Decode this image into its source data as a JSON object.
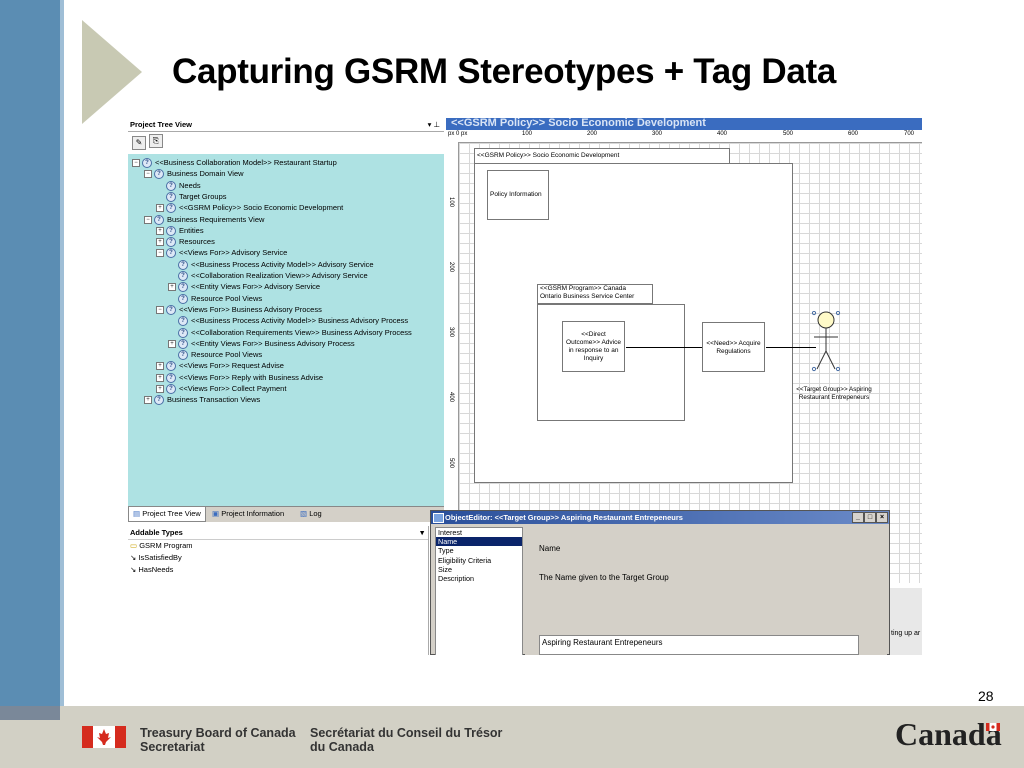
{
  "slide": {
    "title": "Capturing GSRM Stereotypes + Tag Data",
    "page_number": "28",
    "footer": {
      "en_line1": "Treasury Board of Canada",
      "en_line2": "Secretariat",
      "fr_line1": "Secrétariat du Conseil du Trésor",
      "fr_line2": "du Canada",
      "wordmark": "Canada"
    }
  },
  "project_tree": {
    "title": "Project Tree View",
    "pin_glyph": "▾ ⊥",
    "items": [
      {
        "label": "<<Business Collaboration Model>> Restaurant Startup",
        "expander": "−"
      },
      {
        "label": "Business Domain View",
        "expander": "−"
      },
      {
        "label": "Needs",
        "expander": ""
      },
      {
        "label": "Target Groups",
        "expander": ""
      },
      {
        "label": "<<GSRM Policy>> Socio Economic Development",
        "expander": "+"
      },
      {
        "label": "Business Requirements View",
        "expander": "−"
      },
      {
        "label": "Entities",
        "expander": "+"
      },
      {
        "label": "Resources",
        "expander": "+"
      },
      {
        "label": "<<Views For>> Advisory Service",
        "expander": "−"
      },
      {
        "label": "<<Business Process Activity Model>> Advisory Service",
        "expander": ""
      },
      {
        "label": "<<Collaboration Realization View>> Advisory Service",
        "expander": ""
      },
      {
        "label": "<<Entity Views For>> Advisory Service",
        "expander": "+"
      },
      {
        "label": "Resource Pool Views",
        "expander": ""
      },
      {
        "label": "<<Views For>> Business Advisory Process",
        "expander": "−"
      },
      {
        "label": "<<Business Process Activity Model>> Business Advisory Process",
        "expander": ""
      },
      {
        "label": "<<Collaboration Requirements View>> Business Advisory Process",
        "expander": ""
      },
      {
        "label": "<<Entity Views For>> Business Advisory Process",
        "expander": "+"
      },
      {
        "label": "Resource Pool Views",
        "expander": ""
      },
      {
        "label": "<<Views For>> Request Advise",
        "expander": "+"
      },
      {
        "label": "<<Views For>> Reply with Business Advise",
        "expander": "+"
      },
      {
        "label": "<<Views For>> Collect Payment",
        "expander": "+"
      },
      {
        "label": "Business Transaction Views",
        "expander": "+"
      }
    ],
    "tabs": [
      "Project Tree View",
      "Project Information",
      "Log"
    ]
  },
  "addable_types": {
    "title": "Addable Types",
    "items": [
      "GSRM Program",
      "IsSatisfiedBy",
      "HasNeeds"
    ]
  },
  "diagram": {
    "title": "<<GSRM Policy>> Socio Economic Development",
    "ruler_top": [
      "0 px",
      "100",
      "200",
      "300",
      "400",
      "500",
      "600",
      "700"
    ],
    "ruler_left": [
      "100",
      "200",
      "300",
      "400",
      "500"
    ],
    "ruler_origin": "px",
    "frame_label": "<<GSRM Policy>> Socio Economic Development",
    "policy_info": "Policy Information",
    "program_line1": "<<GSRM Program>> Canada",
    "program_line2": "Ontario Business Service Center",
    "outcome": "<<Direct Outcome>> Advice in response to an Inquiry",
    "need": "<<Need>> Acquire Regulations",
    "actor_line1": "<<Target Group>> Aspiring",
    "actor_line2": "Restaurant Entrepeneurs",
    "clipped_text": "ting up ar"
  },
  "object_editor": {
    "title": "ObjectEditor: <<Target Group>> Aspiring Restaurant Entrepeneurs",
    "window_buttons": [
      "_",
      "□",
      "×"
    ],
    "properties": [
      "Interest",
      "Name",
      "Type",
      "Eligibility Criteria",
      "Size",
      "Description"
    ],
    "selected_property": "Name",
    "field_name": "Name",
    "field_description": "The Name given to the Target Group",
    "field_value": "Aspiring Restaurant Entrepeneurs"
  },
  "colors": {
    "tree_bg": "#aee2e3",
    "accent_left": "#5b8db3",
    "selection": "#0a246a"
  }
}
